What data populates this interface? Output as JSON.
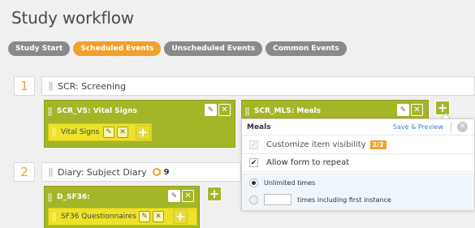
{
  "page": {
    "title": "Study workflow"
  },
  "tabs": [
    {
      "label": "Study Start",
      "active": false
    },
    {
      "label": "Scheduled Events",
      "active": true
    },
    {
      "label": "Unscheduled Events",
      "active": false
    },
    {
      "label": "Common Events",
      "active": false
    }
  ],
  "events": [
    {
      "number": "1",
      "name": "SCR: Screening",
      "forms": [
        {
          "title": "SCR_VS: Vital Signs",
          "items": [
            {
              "label": "Vital Signs"
            }
          ]
        },
        {
          "title": "SCR_MLS: Meals",
          "items": []
        }
      ]
    },
    {
      "number": "2",
      "name": "Diary: Subject Diary",
      "counter": "9",
      "forms": [
        {
          "title": "D_SF36:",
          "items": [
            {
              "label": "SF36 Questionnaires"
            }
          ]
        }
      ]
    }
  ],
  "popup": {
    "title": "Meals",
    "save_label": "Save & Preview",
    "customize_label": "Customize item visibility",
    "customize_badge": "2/2",
    "repeat_label": "Allow form to repeat",
    "repeat_checked": true,
    "unlimited_label": "Unlimited times",
    "times_label": "times including first instance",
    "times_value": ""
  },
  "icons": {
    "edit": "pencil-icon",
    "remove": "close-icon",
    "add": "plus-icon",
    "counter": "repeat-counter-icon",
    "drag": "drag-handle-icon",
    "popup_close": "close-circle-icon"
  },
  "colors": {
    "accent": "#f0a12a",
    "form_green": "#a5b528",
    "item_yellow": "#ece22a",
    "tab_gray": "#8a8a8a",
    "link_blue": "#3a7fc1"
  }
}
